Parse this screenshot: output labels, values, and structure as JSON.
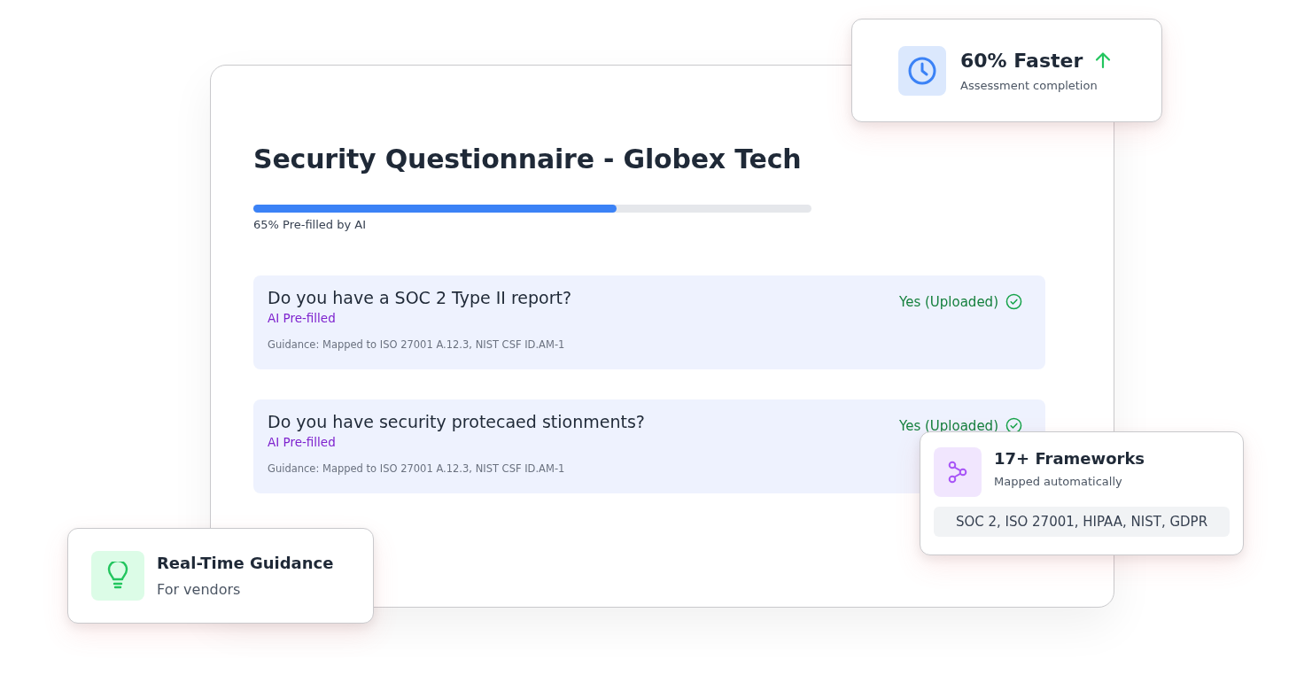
{
  "questionnaire": {
    "title": "Security Questionnaire - Globex Tech",
    "progress": {
      "level": 0.65,
      "label": "65% Pre-filled by AI"
    },
    "questions": [
      {
        "question": "Do you have a SOC 2 Type II report?",
        "tag": "AI Pre-filled",
        "guidance": "Guidance: Mapped to ISO 27001 A.12.3, NIST CSF ID.AM-1",
        "answer": "Yes (Uploaded)"
      },
      {
        "question": "Do you have security protecaed stionments?",
        "tag": "AI Pre-filled",
        "guidance": "Guidance: Mapped to ISO 27001 A.12.3, NIST CSF ID.AM-1",
        "answer": "Yes (Uploaded)"
      }
    ]
  },
  "speed_card": {
    "title": "60% Faster",
    "subtitle": "Assessment completion"
  },
  "frameworks_card": {
    "title": "17+ Frameworks",
    "subtitle": "Mapped automatically",
    "list": "SOC 2, ISO 27001, HIPAA, NIST, GDPR"
  },
  "guidance_card": {
    "title": "Real-Time Guidance",
    "subtitle": "For vendors"
  }
}
